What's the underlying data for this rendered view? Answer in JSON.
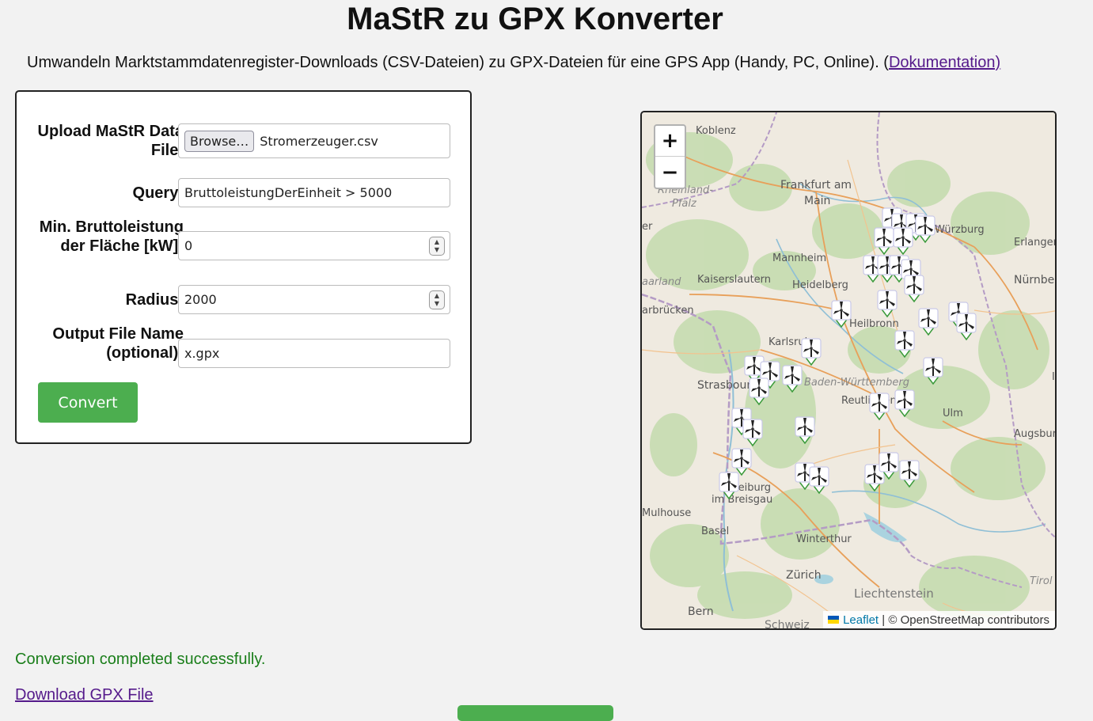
{
  "header": {
    "title": "MaStR zu GPX Konverter",
    "description": "Umwandeln Marktstammdatenregister-Downloads (CSV-Dateien) zu GPX-Dateien für eine GPS App (Handy, PC, Online). (",
    "doc_link": "Dokumentation)"
  },
  "form": {
    "upload_label": "Upload MaStR Data File:",
    "browse_button": "Browse…",
    "file_name": "Stromerzeuger.csv",
    "query_label": "Query:",
    "query_value": "BruttoleistungDerEinheit > 5000",
    "min_label": "Min. Bruttoleistung der Fläche [kW]:",
    "min_value": "0",
    "radius_label": "Radius:",
    "radius_value": "2000",
    "output_label": "Output File Name (optional):",
    "output_value": "x.gpx",
    "convert_button": "Convert"
  },
  "map": {
    "zoom_in": "+",
    "zoom_out": "−",
    "attribution_leaflet": "Leaflet",
    "attribution_osm": "| © OpenStreetMap contributors",
    "marker_icon": "wind-turbine-icon",
    "place_labels": [
      "Koblenz",
      "Frankfurt am",
      "Main",
      "Rheinland-",
      "Pfalz",
      "Mannheim",
      "Kaiserslautern",
      "Heidelberg",
      "Saarland",
      "arbrücken",
      "Heilbronn",
      "Karlsruhe",
      "Strasbourg",
      "Baden-Württemberg",
      "Reutlingen",
      "Ulm",
      "Augsburg",
      "Erlangen",
      "Nürnberg",
      "Würzburg",
      "Freiburg im Breisgau",
      "Mulhouse",
      "Basel",
      "Winterthur",
      "Zürich",
      "Liechtenstein",
      "Bern",
      "Schweiz",
      "Tirol"
    ]
  },
  "status": {
    "message": "Conversion completed successfully.",
    "download_link": "Download GPX File"
  }
}
